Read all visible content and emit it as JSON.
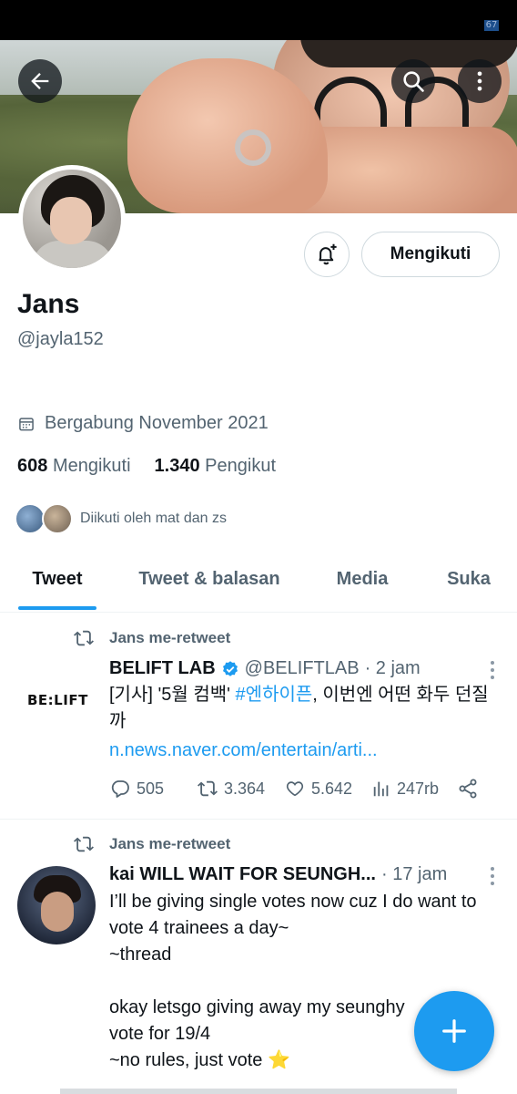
{
  "status_bar": {
    "battery": "67"
  },
  "header": {
    "back_icon": "arrow-left-icon",
    "search_icon": "search-icon",
    "more_icon": "more-vertical-icon"
  },
  "profile": {
    "name": "Jans",
    "handle": "@jayla152",
    "joined": "Bergabung November 2021",
    "following_count": "608",
    "following_label": "Mengikuti",
    "followers_count": "1.340",
    "followers_label": "Pengikut",
    "followed_by": "Diikuti oleh mat dan zs",
    "follow_button": "Mengikuti",
    "notify_icon": "bell-plus-icon"
  },
  "tabs": [
    {
      "label": "Tweet",
      "active": true
    },
    {
      "label": "Tweet & balasan",
      "active": false
    },
    {
      "label": "Media",
      "active": false
    },
    {
      "label": "Suka",
      "active": false
    }
  ],
  "tweets": [
    {
      "retweet_label": "Jans me-retweet",
      "display_name": "BELIFT LAB",
      "verified": true,
      "handle": "@BELIFTLAB",
      "time": "· 2 jam",
      "avatar_text": "BE:LIFT",
      "body_prefix": "[기사] '5월 컴백' ",
      "body_tag": "#엔하이픈",
      "body_suffix": ", 이번엔 어떤 화두 던질까",
      "link": "n.news.naver.com/entertain/arti...",
      "replies": "505",
      "retweets": "3.364",
      "likes": "5.642",
      "views": "247rb"
    },
    {
      "retweet_label": "Jans me-retweet",
      "display_name": "kai WILL WAIT FOR SEUNGH...",
      "handle": "",
      "time": "· 17 jam",
      "lines": [
        "I’ll be giving single votes now cuz I do want to vote 4 trainees a day~",
        "~thread",
        "",
        "okay letsgo giving away my seunghy",
        "vote for 19/4",
        "~no rules, just vote ⭐"
      ]
    }
  ],
  "fab": {
    "icon": "plus-icon"
  },
  "colors": {
    "accent": "#1d9bf0",
    "text": "#0f1419",
    "muted": "#536471"
  }
}
